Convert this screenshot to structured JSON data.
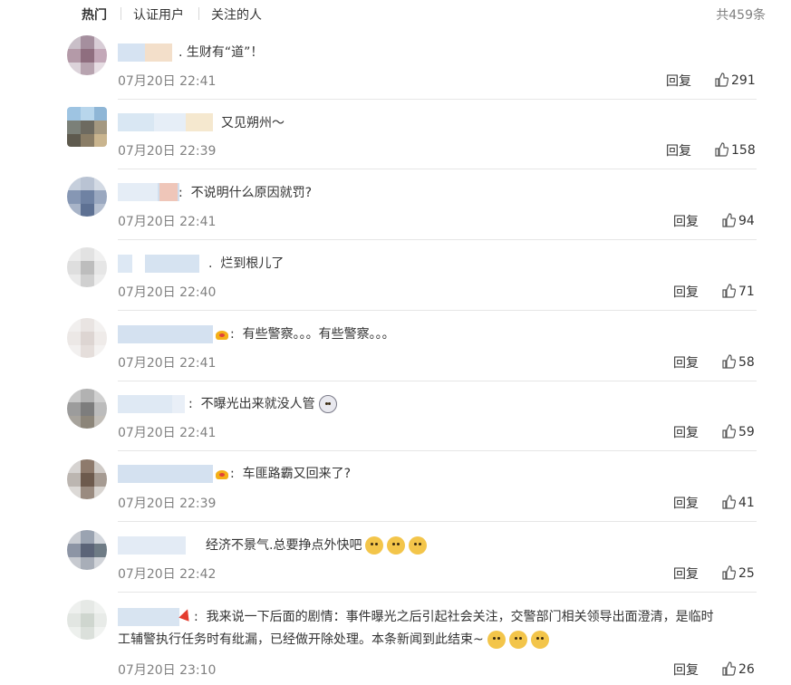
{
  "tabs": [
    "热门",
    "认证用户",
    "关注的人"
  ],
  "total": "共459条",
  "reply_label": "回复",
  "comments": [
    {
      "text": "生财有“道”！",
      "time": "07月20日 22:41",
      "likes": "291"
    },
    {
      "text": "又见朔州～",
      "time": "07月20日 22:39",
      "likes": "158"
    },
    {
      "text": "不说明什么原因就罚?",
      "time": "07月20日 22:41",
      "likes": "94"
    },
    {
      "text": "烂到根儿了",
      "time": "07月20日 22:40",
      "likes": "71"
    },
    {
      "text": "有些警察。。。有些警察。。。",
      "time": "07月20日 22:41",
      "likes": "58"
    },
    {
      "text": "不曝光出来就没人管",
      "time": "07月20日 22:41",
      "likes": "59"
    },
    {
      "text": "车匪路霸又回来了?",
      "time": "07月20日 22:39",
      "likes": "41"
    },
    {
      "text": "经济不景气.总要挣点外快吧",
      "time": "07月20日 22:42",
      "likes": "25"
    },
    {
      "text": "我来说一下后面的剧情：事件曝光之后引起社会关注，交警部门相关领导出面澄清，是临时",
      "text2": "工辅警执行任务时有纰漏，已经做开除处理。本条新闻到此结束~",
      "time": "07月20日 23:10",
      "likes": "26"
    }
  ],
  "icons": {
    "like": "thumbs-up-icon",
    "crown": "crown-badge-icon",
    "emoji": "doge-emoji-icon"
  },
  "colors": {
    "muted": "#808080",
    "text": "#333333",
    "crown": "#f4b018",
    "badge_red": "#e43c2e"
  }
}
